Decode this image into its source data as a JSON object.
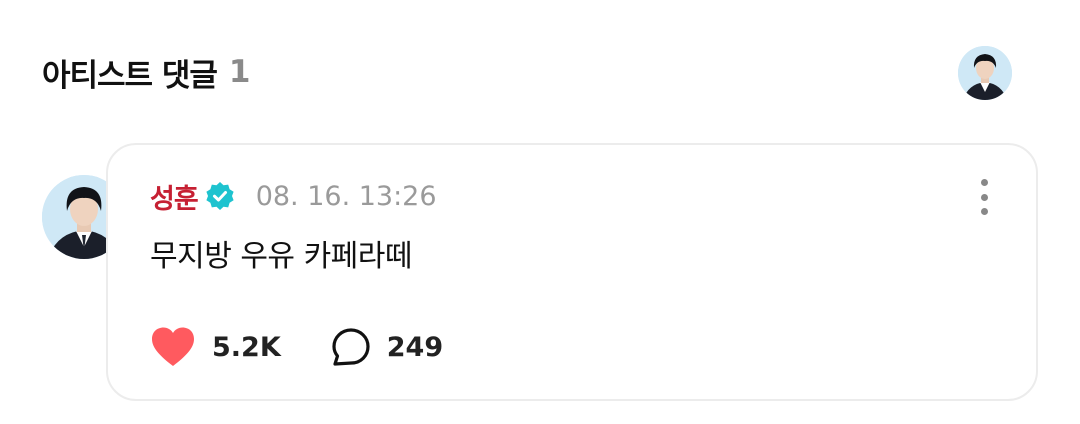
{
  "section": {
    "title": "아티스트 댓글",
    "count": "1"
  },
  "comment": {
    "author": "성훈",
    "verified_icon": "verified-badge-icon",
    "timestamp": "08. 16. 13:26",
    "text": "무지방 우유 카페라떼",
    "likes": "5.2K",
    "replies": "249",
    "more_icon": "more-vertical-icon"
  },
  "colors": {
    "author": "#c62033",
    "verified": "#1ec3cf",
    "heart": "#ff5a5f",
    "muted": "#9a9a9a",
    "border": "#ececec"
  }
}
